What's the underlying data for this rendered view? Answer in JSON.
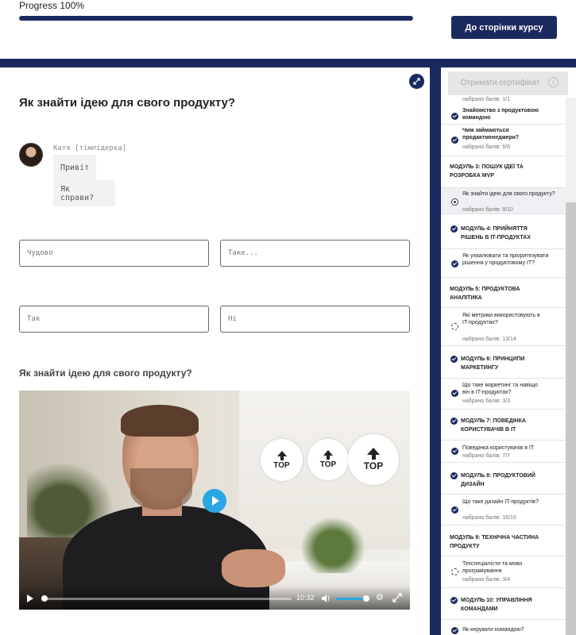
{
  "header": {
    "progress_label": "Progress 100%",
    "progress_value": 1.0,
    "course_button": "До сторінки курсу"
  },
  "lesson": {
    "title": "Як знайти ідею для свого продукту?",
    "chat": {
      "name": "Катя [тімлідерка]",
      "messages": [
        "Привіт",
        "Як справи?"
      ]
    },
    "answers": [
      "Чудово",
      "Таке...",
      "Так",
      "Ні"
    ],
    "video_title": "Як знайти ідею для свого продукту?",
    "video": {
      "time": "10:32",
      "badges": [
        "TOP",
        "TOP",
        "TOP"
      ]
    }
  },
  "sidebar": {
    "certificate_button": "Отримати сертифікат",
    "items": [
      {
        "type": "score",
        "score": "набрано балів: 1/1"
      },
      {
        "type": "lesson",
        "status": "check",
        "title": "Знайомство з продуктовою командою"
      },
      {
        "type": "lesson",
        "status": "check",
        "title": "Чим займаються продактменеджери?",
        "score": "набрано балів: 6/6"
      },
      {
        "type": "module",
        "title": "МОДУЛЬ 3: ПОШУК ІДЕЇ ТА РОЗРОБКА MVP"
      },
      {
        "type": "lesson",
        "status": "radio",
        "title": "Як знайти ідею для свого продукту?",
        "score": "набрано балів: 9/10"
      },
      {
        "type": "module",
        "title": "МОДУЛЬ 4: ПРИЙНЯТТЯ РІШЕНЬ В IT-ПРОДУКТАХ"
      },
      {
        "type": "lesson",
        "status": "check",
        "title": "Як ухвалювати та пріоритезувати рішення у продуктовому IT?"
      },
      {
        "type": "module",
        "title": "МОДУЛЬ 5: ПРОДУКТОВА АНАЛІТИКА"
      },
      {
        "type": "lesson",
        "status": "partial",
        "title": "Які метрики використовують в IT-продуктах?",
        "score": "набрано балів: 13/14"
      },
      {
        "type": "module",
        "title": "МОДУЛЬ 6: ПРИНЦИПИ МАРКЕТИНГУ"
      },
      {
        "type": "lesson",
        "status": "check",
        "title": "Що таке маркетинг та навіщо він в IT-продуктах?",
        "score": "набрано балів: 3/3"
      },
      {
        "type": "module",
        "title": "МОДУЛЬ 7: ПОВЕДІНКА КОРИСТУВАЧІВ В IT"
      },
      {
        "type": "lesson",
        "status": "check",
        "title": "Поведінка користувачів в IT",
        "score": "набрано балів: 7/7"
      },
      {
        "type": "module",
        "title": "МОДУЛЬ 8: ПРОДУКТОВИЙ ДИЗАЙН"
      },
      {
        "type": "lesson",
        "status": "check",
        "title": "Що таке дизайн IT-продуктів?",
        "score": "набрано балів: 16/16"
      },
      {
        "type": "module",
        "title": "МОДУЛЬ 9: ТЕХНІЧНА ЧАСТИНА ПРОДУКТУ"
      },
      {
        "type": "lesson",
        "status": "partial",
        "title": "Техспеціалісти та мови програмування",
        "score": "набрано балів: 3/4"
      },
      {
        "type": "module",
        "title": "МОДУЛЬ 10: УПРАВЛІННЯ КОМАНДАМИ"
      },
      {
        "type": "lesson",
        "status": "check",
        "title": "Як керувати командою?"
      }
    ]
  },
  "colors": {
    "brand": "#1b2a5e",
    "accent": "#2aa6e5"
  },
  "icons": {
    "expand": "expand-arrows-icon",
    "info": "info-icon",
    "check": "check-circle-icon",
    "radio": "radio-current-icon",
    "partial": "partial-circle-icon",
    "play": "play-icon",
    "volume": "volume-icon",
    "settings": "gear-icon",
    "fullscreen": "fullscreen-icon"
  }
}
